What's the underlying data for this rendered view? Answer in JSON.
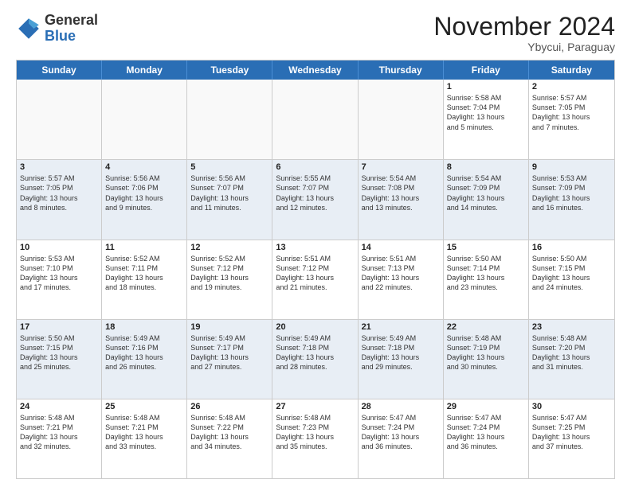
{
  "logo": {
    "general": "General",
    "blue": "Blue"
  },
  "title": "November 2024",
  "location": "Ybycui, Paraguay",
  "days": [
    "Sunday",
    "Monday",
    "Tuesday",
    "Wednesday",
    "Thursday",
    "Friday",
    "Saturday"
  ],
  "rows": [
    [
      {
        "day": "",
        "lines": []
      },
      {
        "day": "",
        "lines": []
      },
      {
        "day": "",
        "lines": []
      },
      {
        "day": "",
        "lines": []
      },
      {
        "day": "",
        "lines": []
      },
      {
        "day": "1",
        "lines": [
          "Sunrise: 5:58 AM",
          "Sunset: 7:04 PM",
          "Daylight: 13 hours",
          "and 5 minutes."
        ]
      },
      {
        "day": "2",
        "lines": [
          "Sunrise: 5:57 AM",
          "Sunset: 7:05 PM",
          "Daylight: 13 hours",
          "and 7 minutes."
        ]
      }
    ],
    [
      {
        "day": "3",
        "lines": [
          "Sunrise: 5:57 AM",
          "Sunset: 7:05 PM",
          "Daylight: 13 hours",
          "and 8 minutes."
        ]
      },
      {
        "day": "4",
        "lines": [
          "Sunrise: 5:56 AM",
          "Sunset: 7:06 PM",
          "Daylight: 13 hours",
          "and 9 minutes."
        ]
      },
      {
        "day": "5",
        "lines": [
          "Sunrise: 5:56 AM",
          "Sunset: 7:07 PM",
          "Daylight: 13 hours",
          "and 11 minutes."
        ]
      },
      {
        "day": "6",
        "lines": [
          "Sunrise: 5:55 AM",
          "Sunset: 7:07 PM",
          "Daylight: 13 hours",
          "and 12 minutes."
        ]
      },
      {
        "day": "7",
        "lines": [
          "Sunrise: 5:54 AM",
          "Sunset: 7:08 PM",
          "Daylight: 13 hours",
          "and 13 minutes."
        ]
      },
      {
        "day": "8",
        "lines": [
          "Sunrise: 5:54 AM",
          "Sunset: 7:09 PM",
          "Daylight: 13 hours",
          "and 14 minutes."
        ]
      },
      {
        "day": "9",
        "lines": [
          "Sunrise: 5:53 AM",
          "Sunset: 7:09 PM",
          "Daylight: 13 hours",
          "and 16 minutes."
        ]
      }
    ],
    [
      {
        "day": "10",
        "lines": [
          "Sunrise: 5:53 AM",
          "Sunset: 7:10 PM",
          "Daylight: 13 hours",
          "and 17 minutes."
        ]
      },
      {
        "day": "11",
        "lines": [
          "Sunrise: 5:52 AM",
          "Sunset: 7:11 PM",
          "Daylight: 13 hours",
          "and 18 minutes."
        ]
      },
      {
        "day": "12",
        "lines": [
          "Sunrise: 5:52 AM",
          "Sunset: 7:12 PM",
          "Daylight: 13 hours",
          "and 19 minutes."
        ]
      },
      {
        "day": "13",
        "lines": [
          "Sunrise: 5:51 AM",
          "Sunset: 7:12 PM",
          "Daylight: 13 hours",
          "and 21 minutes."
        ]
      },
      {
        "day": "14",
        "lines": [
          "Sunrise: 5:51 AM",
          "Sunset: 7:13 PM",
          "Daylight: 13 hours",
          "and 22 minutes."
        ]
      },
      {
        "day": "15",
        "lines": [
          "Sunrise: 5:50 AM",
          "Sunset: 7:14 PM",
          "Daylight: 13 hours",
          "and 23 minutes."
        ]
      },
      {
        "day": "16",
        "lines": [
          "Sunrise: 5:50 AM",
          "Sunset: 7:15 PM",
          "Daylight: 13 hours",
          "and 24 minutes."
        ]
      }
    ],
    [
      {
        "day": "17",
        "lines": [
          "Sunrise: 5:50 AM",
          "Sunset: 7:15 PM",
          "Daylight: 13 hours",
          "and 25 minutes."
        ]
      },
      {
        "day": "18",
        "lines": [
          "Sunrise: 5:49 AM",
          "Sunset: 7:16 PM",
          "Daylight: 13 hours",
          "and 26 minutes."
        ]
      },
      {
        "day": "19",
        "lines": [
          "Sunrise: 5:49 AM",
          "Sunset: 7:17 PM",
          "Daylight: 13 hours",
          "and 27 minutes."
        ]
      },
      {
        "day": "20",
        "lines": [
          "Sunrise: 5:49 AM",
          "Sunset: 7:18 PM",
          "Daylight: 13 hours",
          "and 28 minutes."
        ]
      },
      {
        "day": "21",
        "lines": [
          "Sunrise: 5:49 AM",
          "Sunset: 7:18 PM",
          "Daylight: 13 hours",
          "and 29 minutes."
        ]
      },
      {
        "day": "22",
        "lines": [
          "Sunrise: 5:48 AM",
          "Sunset: 7:19 PM",
          "Daylight: 13 hours",
          "and 30 minutes."
        ]
      },
      {
        "day": "23",
        "lines": [
          "Sunrise: 5:48 AM",
          "Sunset: 7:20 PM",
          "Daylight: 13 hours",
          "and 31 minutes."
        ]
      }
    ],
    [
      {
        "day": "24",
        "lines": [
          "Sunrise: 5:48 AM",
          "Sunset: 7:21 PM",
          "Daylight: 13 hours",
          "and 32 minutes."
        ]
      },
      {
        "day": "25",
        "lines": [
          "Sunrise: 5:48 AM",
          "Sunset: 7:21 PM",
          "Daylight: 13 hours",
          "and 33 minutes."
        ]
      },
      {
        "day": "26",
        "lines": [
          "Sunrise: 5:48 AM",
          "Sunset: 7:22 PM",
          "Daylight: 13 hours",
          "and 34 minutes."
        ]
      },
      {
        "day": "27",
        "lines": [
          "Sunrise: 5:48 AM",
          "Sunset: 7:23 PM",
          "Daylight: 13 hours",
          "and 35 minutes."
        ]
      },
      {
        "day": "28",
        "lines": [
          "Sunrise: 5:47 AM",
          "Sunset: 7:24 PM",
          "Daylight: 13 hours",
          "and 36 minutes."
        ]
      },
      {
        "day": "29",
        "lines": [
          "Sunrise: 5:47 AM",
          "Sunset: 7:24 PM",
          "Daylight: 13 hours",
          "and 36 minutes."
        ]
      },
      {
        "day": "30",
        "lines": [
          "Sunrise: 5:47 AM",
          "Sunset: 7:25 PM",
          "Daylight: 13 hours",
          "and 37 minutes."
        ]
      }
    ]
  ],
  "altRows": [
    1,
    3
  ],
  "colors": {
    "header_bg": "#2a6eb5",
    "header_text": "#ffffff",
    "alt_row_bg": "#e8eef5",
    "cell_bg": "#ffffff",
    "empty_bg": "#f5f5f5"
  }
}
